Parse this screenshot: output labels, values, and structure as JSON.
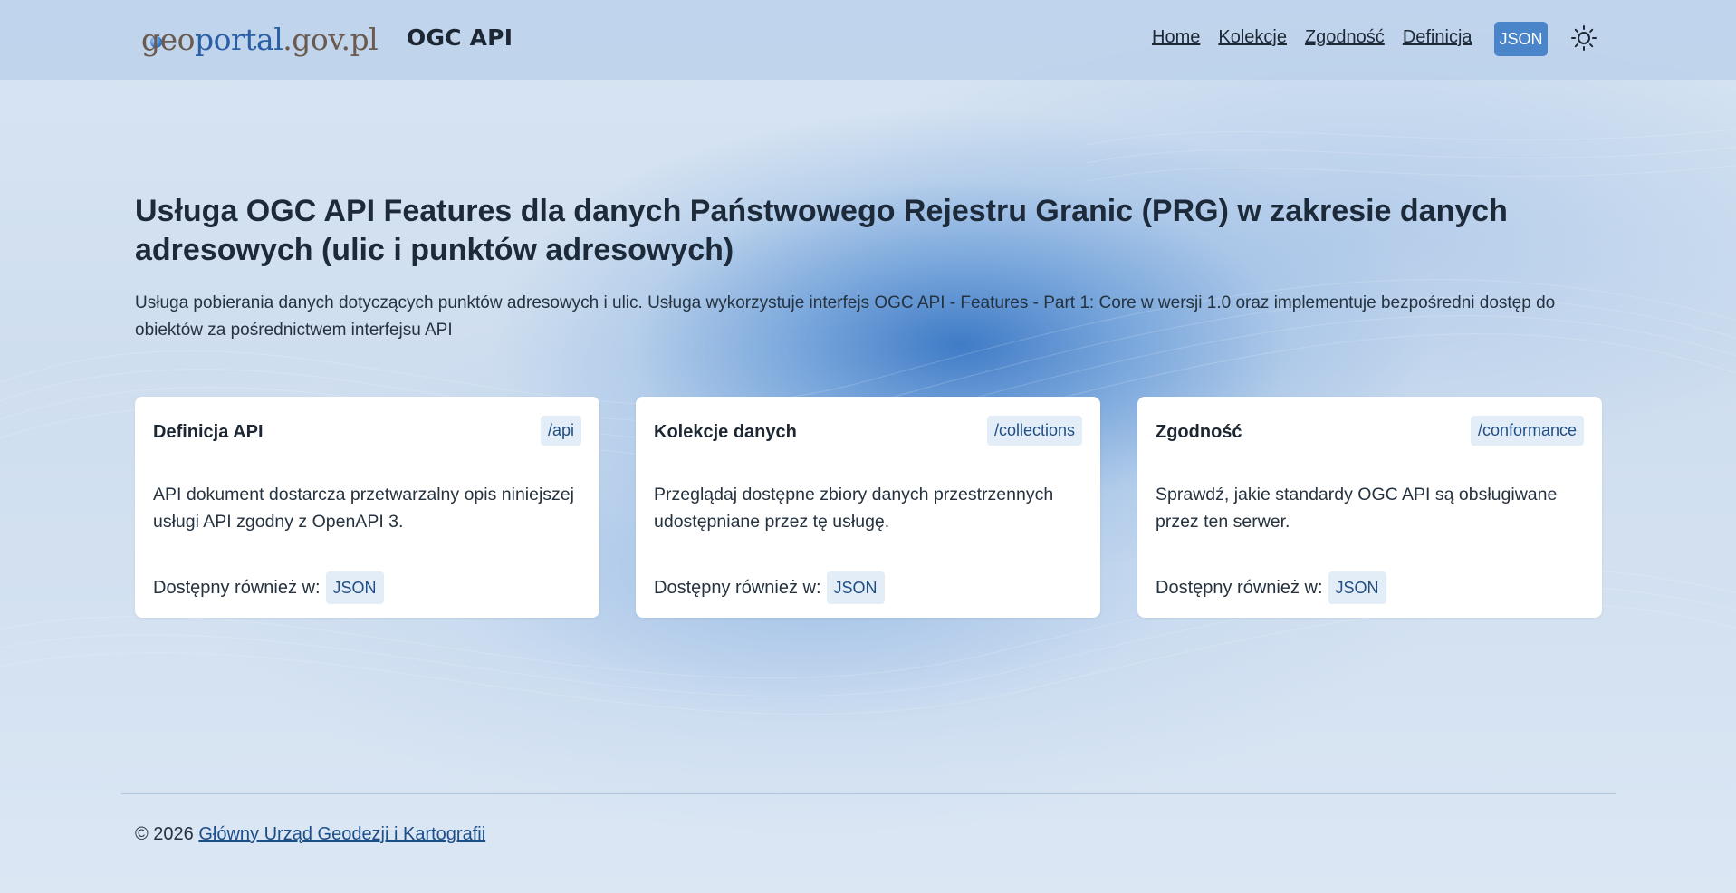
{
  "header": {
    "logo": {
      "g": "g",
      "eo": "eo",
      "portal": "portal",
      "gov": ".gov.pl"
    },
    "app_title": "OGC API",
    "nav": [
      {
        "label": "Home"
      },
      {
        "label": "Kolekcje"
      },
      {
        "label": "Zgodność"
      },
      {
        "label": "Definicja"
      }
    ],
    "json_button": "JSON",
    "theme_icon": "sun-icon"
  },
  "main": {
    "title": "Usługa OGC API Features dla danych Państwowego Rejestru Granic (PRG) w zakresie danych adresowych (ulic i punktów adresowych)",
    "description": "Usługa pobierania danych dotyczących punktów adresowych i ulic. Usługa wykorzystuje interfejs OGC API - Features - Part 1: Core w wersji 1.0 oraz implementuje bezpośredni dostęp do obiektów za pośrednictwem interfejsu API",
    "cards": [
      {
        "title": "Definicja API",
        "badge": "/api",
        "text": "API dokument dostarcza przetwarzalny opis niniejszej usługi API zgodny z OpenAPI 3.",
        "also_label": "Dostępny również w:",
        "format": "JSON"
      },
      {
        "title": "Kolekcje danych",
        "badge": "/collections",
        "text": "Przeglądaj dostępne zbiory danych przestrzennych udostępniane przez tę usługę.",
        "also_label": "Dostępny również w:",
        "format": "JSON"
      },
      {
        "title": "Zgodność",
        "badge": "/conformance",
        "text": "Sprawdź, jakie standardy OGC API są obsługiwane przez ten serwer.",
        "also_label": "Dostępny również w:",
        "format": "JSON"
      }
    ]
  },
  "footer": {
    "copyright": "© 2026",
    "link": "Główny Urząd Geodezji i Kartografii"
  },
  "colors": {
    "accent": "#4a85c9",
    "badge_bg": "#e3edf7",
    "badge_text": "#1f4f85"
  }
}
